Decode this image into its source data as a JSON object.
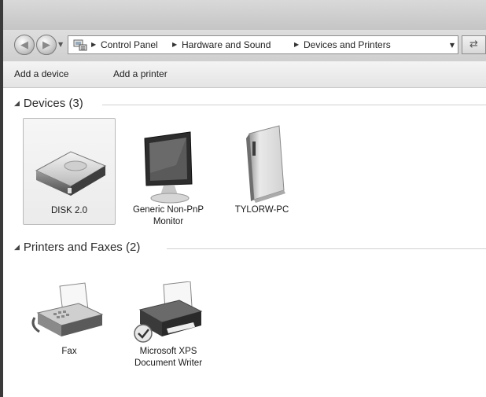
{
  "address_bar": {
    "crumbs": [
      "Control Panel",
      "Hardware and Sound",
      "Devices and Printers"
    ]
  },
  "toolbar": {
    "add_device_label": "Add a device",
    "add_printer_label": "Add a printer"
  },
  "groups": {
    "devices": {
      "header": "Devices (3)",
      "items": [
        {
          "label": "DISK 2.0",
          "icon": "disk-drive-icon"
        },
        {
          "label": "Generic Non-PnP\nMonitor",
          "icon": "monitor-icon"
        },
        {
          "label": "TYLORW-PC",
          "icon": "computer-tower-icon"
        }
      ]
    },
    "printers": {
      "header": "Printers and Faxes (2)",
      "items": [
        {
          "label": "Fax",
          "icon": "fax-icon"
        },
        {
          "label": "Microsoft XPS\nDocument Writer",
          "icon": "printer-icon"
        }
      ]
    }
  }
}
